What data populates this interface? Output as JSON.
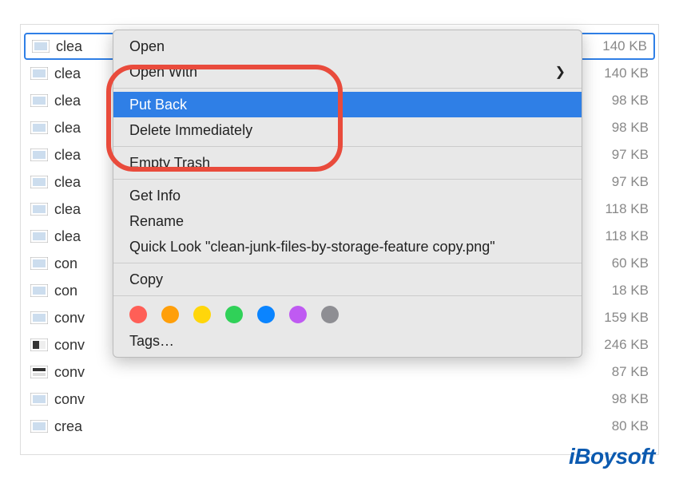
{
  "files": [
    {
      "name": "clea",
      "size": "140 KB",
      "icon": "image",
      "selected": true
    },
    {
      "name": "clea",
      "size": "140 KB",
      "icon": "image"
    },
    {
      "name": "clea",
      "size": "98 KB",
      "icon": "image"
    },
    {
      "name": "clea",
      "size": "98 KB",
      "icon": "image"
    },
    {
      "name": "clea",
      "size": "97 KB",
      "icon": "image"
    },
    {
      "name": "clea",
      "size": "97 KB",
      "icon": "image"
    },
    {
      "name": "clea",
      "size": "118 KB",
      "icon": "image"
    },
    {
      "name": "clea",
      "size": "118 KB",
      "icon": "image"
    },
    {
      "name": "con",
      "size": "60 KB",
      "icon": "image"
    },
    {
      "name": "con",
      "size": "18 KB",
      "icon": "image"
    },
    {
      "name": "conv",
      "size": "159 KB",
      "icon": "image"
    },
    {
      "name": "conv",
      "size": "246 KB",
      "icon": "image-dark"
    },
    {
      "name": "conv",
      "size": "87 KB",
      "icon": "image-bw"
    },
    {
      "name": "conv",
      "size": "98 KB",
      "icon": "image"
    },
    {
      "name": "crea",
      "size": "80 KB",
      "icon": "image"
    }
  ],
  "menu": {
    "open": "Open",
    "open_with": "Open With",
    "put_back": "Put Back",
    "delete_immediately": "Delete Immediately",
    "empty_trash": "Empty Trash",
    "get_info": "Get Info",
    "rename": "Rename",
    "quick_look": "Quick Look \"clean-junk-files-by-storage-feature copy.png\"",
    "copy": "Copy",
    "tags_label": "Tags…",
    "tag_colors": [
      "#ff5f57",
      "#ff9f0a",
      "#ffd60a",
      "#30d158",
      "#0a84ff",
      "#bf5af2",
      "#8e8e93"
    ]
  },
  "watermark": "iBoysoft"
}
